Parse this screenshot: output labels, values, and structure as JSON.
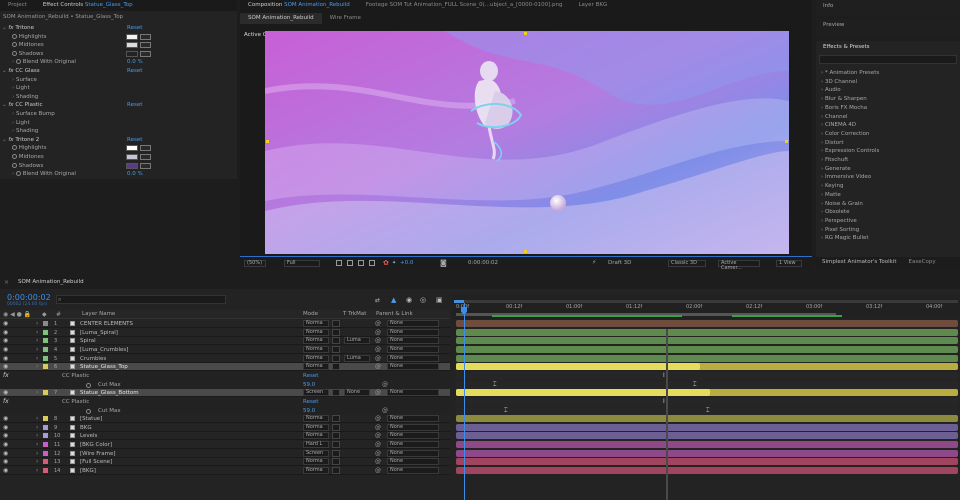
{
  "top_tabs": {
    "project": "Project",
    "effect_controls_prefix": "Effect Controls",
    "effect_controls_layer": "Statue_Glass_Top",
    "composition_prefix": "Composition",
    "composition_name": "SOM Animation_Rebuild",
    "footage": "Footage SOM Tut Animation_FULL Scene_0(...ubject_a_[0000-0100].png",
    "layer": "Layer BKG",
    "info": "Info",
    "preview": "Preview"
  },
  "effect_controls": {
    "breadcrumb": "SOM Animation_Rebuild • Statue_Glass_Top",
    "effects": [
      {
        "name": "Tritone",
        "reset": "Reset",
        "props": [
          "Highlights",
          "Midtones",
          "Shadows"
        ],
        "blend_label": "Blend With Original",
        "blend_value": "0.0 %",
        "colors": [
          "#f2f2f2",
          "#dcdcdc",
          "#222222"
        ]
      },
      {
        "name": "CC Glass",
        "reset": "Reset",
        "props": [
          "Surface",
          "Light",
          "Shading"
        ]
      },
      {
        "name": "CC Plastic",
        "reset": "Reset",
        "props": [
          "Surface Bump",
          "Light",
          "Shading"
        ]
      },
      {
        "name": "Tritone 2",
        "reset": "Reset",
        "props": [
          "Highlights",
          "Midtones",
          "Shadows"
        ],
        "blend_label": "Blend With Original",
        "blend_value": "0.0 %",
        "colors": [
          "#ffffff",
          "#c9c4d4",
          "#5a3a86"
        ]
      }
    ]
  },
  "composition": {
    "subtabs": [
      "SOM Animation_Rebuild",
      "Wire Frame"
    ],
    "camera_label": "Active Camera (Camera)",
    "footer": {
      "zoom": "(50%)",
      "resolution": "Full",
      "exposure": "+0.0",
      "timecode": "0:00:00:02",
      "renderer": "Draft 3D",
      "renderer_mode": "Classic 3D",
      "camera": "Active Camer...",
      "views": "1 View"
    }
  },
  "effects_presets": {
    "title": "Effects & Presets",
    "items": [
      "* Animation Presets",
      "3D Channel",
      "Audio",
      "Blur & Sharpen",
      "Boris FX Mocha",
      "Channel",
      "CINEMA 4D",
      "Color Correction",
      "Distort",
      "Expression Controls",
      "Fitschuft",
      "Generate",
      "Immersive Video",
      "Keying",
      "Matte",
      "Noise & Grain",
      "Obsolete",
      "Perspective",
      "Pixel Sorting",
      "RG Magic Bullet"
    ],
    "bottom_tabs": [
      "Simplest Animator's Toolkit",
      "EaseCopy"
    ]
  },
  "timeline": {
    "tab": "SOM Animation_Rebuild",
    "timecode": "0:00:00:02",
    "subcode": "00002 (24.00 fps)",
    "headers": {
      "layer_name": "Layer Name",
      "mode": "Mode",
      "trkmat": "T TrkMat",
      "parent": "Parent & Link"
    },
    "ruler": [
      "0:00f",
      "00:12f",
      "01:00f",
      "01:12f",
      "02:00f",
      "02:12f",
      "03:00f",
      "03:12f",
      "04:00f"
    ],
    "layers": [
      {
        "num": "1",
        "name": "CENTER ELEMENTS",
        "mode": "Norma",
        "trk": "",
        "parent": "None",
        "color": "#8a8a8a",
        "bar": "#6e4d3f"
      },
      {
        "num": "2",
        "name": "[Luma_Spiral]",
        "mode": "Norma",
        "trk": "",
        "parent": "None",
        "color": "#7cc47c",
        "bar": "#5e8a4e"
      },
      {
        "num": "3",
        "name": "Spiral",
        "mode": "Norma",
        "trk": "Luma",
        "parent": "None",
        "color": "#7cc47c",
        "bar": "#5e8a4e"
      },
      {
        "num": "4",
        "name": "[Luma_Crumbles]",
        "mode": "Norma",
        "trk": "",
        "parent": "None",
        "color": "#7cc47c",
        "bar": "#5e8a4e"
      },
      {
        "num": "5",
        "name": "Crumbles",
        "mode": "Norma",
        "trk": "Luma",
        "parent": "None",
        "color": "#7cc47c",
        "bar": "#5e8a4e"
      },
      {
        "num": "6",
        "name": "Statue_Glass_Top",
        "mode": "Norma",
        "trk": "",
        "parent": "None",
        "color": "#d8cc5a",
        "bar": "#b8ad3e",
        "selected": true
      },
      {
        "num": "7",
        "name": "Statue_Glass_Bottom",
        "mode": "Screen",
        "trk": "None",
        "parent": "None",
        "color": "#d8cc5a",
        "bar": "#b8ad3e",
        "selected": true
      },
      {
        "num": "8",
        "name": "[Statue]",
        "mode": "Norma",
        "trk": "",
        "parent": "None",
        "color": "#d8cc5a",
        "bar": "#8c8a3e"
      },
      {
        "num": "9",
        "name": "BKG",
        "mode": "Norma",
        "trk": "",
        "parent": "None",
        "color": "#a99ad8",
        "bar": "#6c5f94"
      },
      {
        "num": "10",
        "name": "Levels",
        "mode": "Norma",
        "trk": "",
        "parent": "None",
        "color": "#a99ad8",
        "bar": "#6c5f94"
      },
      {
        "num": "11",
        "name": "[BKG Color]",
        "mode": "Hard L",
        "trk": "",
        "parent": "None",
        "color": "#c95ec4",
        "bar": "#8e4a88"
      },
      {
        "num": "12",
        "name": "[Wire Frame]",
        "mode": "Screen",
        "trk": "",
        "parent": "None",
        "color": "#c95ec4",
        "bar": "#8e4a88"
      },
      {
        "num": "13",
        "name": "[Full Scene]",
        "mode": "Norma",
        "trk": "",
        "parent": "None",
        "color": "#d85a7a",
        "bar": "#a14460"
      },
      {
        "num": "14",
        "name": "[BKG]",
        "mode": "Norma",
        "trk": "",
        "parent": "None",
        "color": "#d85a7a",
        "bar": "#a14460"
      }
    ],
    "sub_rows": {
      "cc_plastic": "CC Plastic",
      "reset": "Reset",
      "cut_max": "Cut Max",
      "cut_value": "59.0"
    }
  }
}
